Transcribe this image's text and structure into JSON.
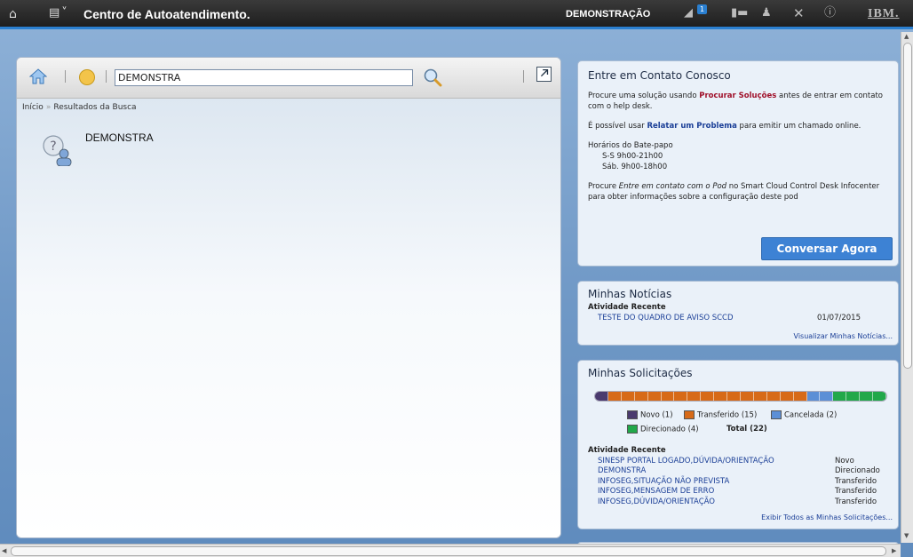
{
  "topbar": {
    "home_icon": "home-icon",
    "menu_icon": "menu-icon",
    "title": "Centro de Autoatendimento.",
    "context": "DEMONSTRAÇÃO",
    "notification_count": "1",
    "logo_text": "IBM."
  },
  "left_panel": {
    "search_value": "DEMONSTRA",
    "breadcrumb": {
      "home": "Início",
      "separator": "»",
      "current": "Resultados da Busca"
    },
    "result": {
      "title": "DEMONSTRA"
    }
  },
  "contact_card": {
    "title": "Entre em Contato Conosco",
    "p1_before": "Procure uma solução usando ",
    "p1_link": "Procurar Soluções",
    "p1_after": " antes de entrar em contato com o help desk.",
    "p2_before": "É possível usar ",
    "p2_link": "Relatar um Problema",
    "p2_after": " para emitir um chamado online.",
    "hours_title": "Horários do Bate-papo",
    "hours_line1": "S-S 9h00-21h00",
    "hours_line2": "Sáb. 9h00-18h00",
    "p4_before": "Procure ",
    "p4_em": "Entre em contato com o Pod",
    "p4_after": " no Smart Cloud Control Desk Infocenter para obter informações sobre a configuração deste pod",
    "chat_button": "Conversar Agora"
  },
  "news_card": {
    "title": "Minhas Notícias",
    "recent_label": "Atividade Recente",
    "item_title": "TESTE DO QUADRO DE AVISO SCCD",
    "item_date": "01/07/2015",
    "view_all": "Visualizar Minhas Notícias..."
  },
  "requests_card": {
    "title": "Minhas Solicitações",
    "legend": {
      "novo": "Novo (1)",
      "transferido": "Transferido (15)",
      "cancelada": "Cancelada (2)",
      "direcionado": "Direcionado (4)",
      "total": "Total (22)"
    },
    "counts": {
      "novo": 1,
      "transferido": 15,
      "cancelada": 2,
      "direcionado": 4
    },
    "colors": {
      "novo": "#4a3a6e",
      "transferido": "#d76a18",
      "cancelada": "#5c8fd6",
      "direcionado": "#22a84a"
    },
    "recent_label": "Atividade Recente",
    "items": [
      {
        "name": "SINESP PORTAL LOGADO,DÚVIDA/ORIENTAÇÃO",
        "status": "Novo"
      },
      {
        "name": "DEMONSTRA",
        "status": "Direcionado"
      },
      {
        "name": "INFOSEG,SITUAÇÃO NÃO PREVISTA",
        "status": "Transferido"
      },
      {
        "name": "INFOSEG,MENSAGEM DE ERRO",
        "status": "Transferido"
      },
      {
        "name": "INFOSEG,DÚVIDA/ORIENTAÇÃO",
        "status": "Transferido"
      }
    ],
    "view_all": "Exibir Todos as Minhas Solicitações..."
  }
}
